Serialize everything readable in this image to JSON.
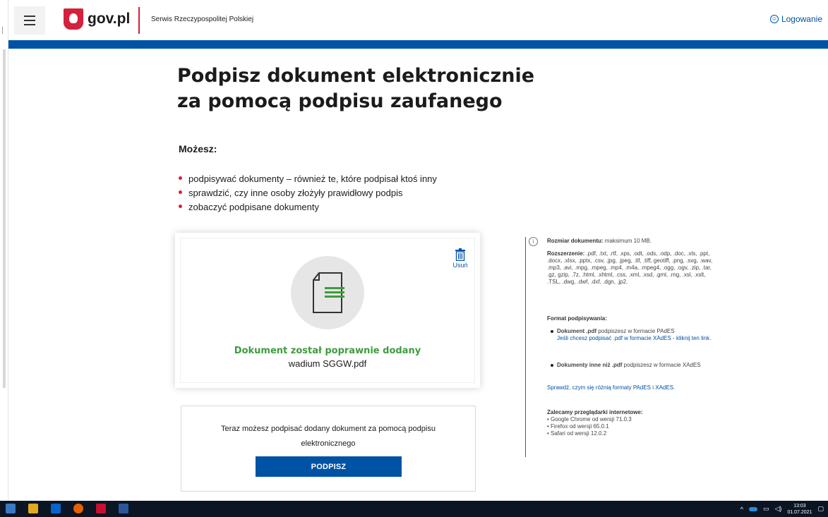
{
  "header": {
    "logo_text": "gov.pl",
    "service_name": "Serwis Rzeczypospolitej Polskiej",
    "login_label": "Logowanie"
  },
  "main": {
    "title_line1": "Podpisz dokument elektronicznie",
    "title_line2": "za pomocą podpisu zaufanego",
    "subheading": "Możesz:",
    "bullets": [
      "podpisywać dokumenty – również te, które podpisał ktoś inny",
      "sprawdzić, czy inne osoby złożyły prawidłowy podpis",
      "zobaczyć podpisane dokumenty"
    ]
  },
  "upload": {
    "delete_label": "Usuń",
    "success_message": "Dokument został poprawnie dodany",
    "file_name": "wadium SGGW.pdf"
  },
  "sign": {
    "text": "Teraz możesz podpisać dodany dokument za pomocą podpisu elektronicznego",
    "button_label": "PODPISZ"
  },
  "info": {
    "size_label": "Rozmiar dokumentu:",
    "size_value": " maksimum 10 MB.",
    "ext_label": "Rozszerzenie:",
    "ext_value": " .pdf, .txt, .rtf, .xps, .odt, .ods, .odp, .doc, .xls, .ppt, .docx, .xlsx, .pptx, .csv, .jpg, .jpeg, .tif, .tiff, geotiff, .png, .svg, .wav, .mp3, .avi, .mpg, .mpeg, .mp4, .m4a, .mpeg4, .ogg, .ogv, .zip, .tar, .gz, gzip, .7z, .html, .xhtml, .css, .xml, .xsd, .gml, .rng, .xsl, .xslt, .TSL, .dwg, .dwf, .dxf, .dgn, .jp2.",
    "format_heading": "Format podpisywania:",
    "pdf_label": "Dokument .pdf",
    "pdf_text": " podpiszesz w formacie PAdES",
    "pdf_link": "Jeśli chcesz podpisać .pdf w formacie XAdES - kliknij ten link.",
    "other_label": "Dokumenty inne niż .pdf",
    "other_text": " podpiszesz w formacie XAdES",
    "compare_link": "Sprawdź, czym się różnią formaty PAdES i XAdES.",
    "browsers_heading": "Zalecamy przeglądarki internetowe:",
    "browsers": [
      "• Google Chrome od wersji 71.0.3",
      "• Firefox od wersji 65.0.1",
      "• Safari od wersji 12.0.2"
    ]
  },
  "taskbar": {
    "time": "13:03",
    "date": "01.07.2021"
  },
  "colors": {
    "brand_blue": "#0052a5",
    "brand_red": "#d4213d",
    "success_green": "#3e9c3e"
  },
  "icons": [
    "menu-icon",
    "emblem-icon",
    "user-icon",
    "document-icon",
    "trash-icon",
    "info-icon"
  ]
}
